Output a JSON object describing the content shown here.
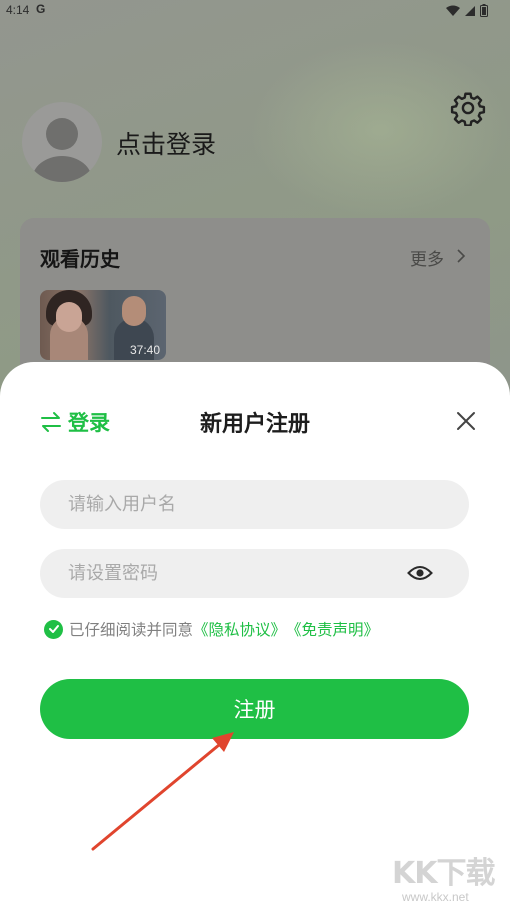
{
  "status_bar": {
    "time": "4:14",
    "g_label": "G",
    "icons": [
      "wifi-icon",
      "signal-icon",
      "battery-icon"
    ]
  },
  "profile": {
    "login_prompt": "点击登录",
    "settings_icon": "gear-icon"
  },
  "history": {
    "title": "观看历史",
    "more_label": "更多",
    "items": [
      {
        "duration": "37:40"
      }
    ]
  },
  "register_sheet": {
    "switch_label": "登录",
    "title": "新用户注册",
    "username_placeholder": "请输入用户名",
    "password_placeholder": "请设置密码",
    "agree_text": "已仔细阅读并同意",
    "privacy_link": "《隐私协议》",
    "disclaimer_link": "《免责声明》",
    "agreed": true,
    "submit_label": "注册"
  },
  "watermark": {
    "logo_text": "KK下载",
    "url": "www.kkx.net"
  },
  "colors": {
    "accent": "#1fbf45",
    "arrow": "#e0452e"
  }
}
